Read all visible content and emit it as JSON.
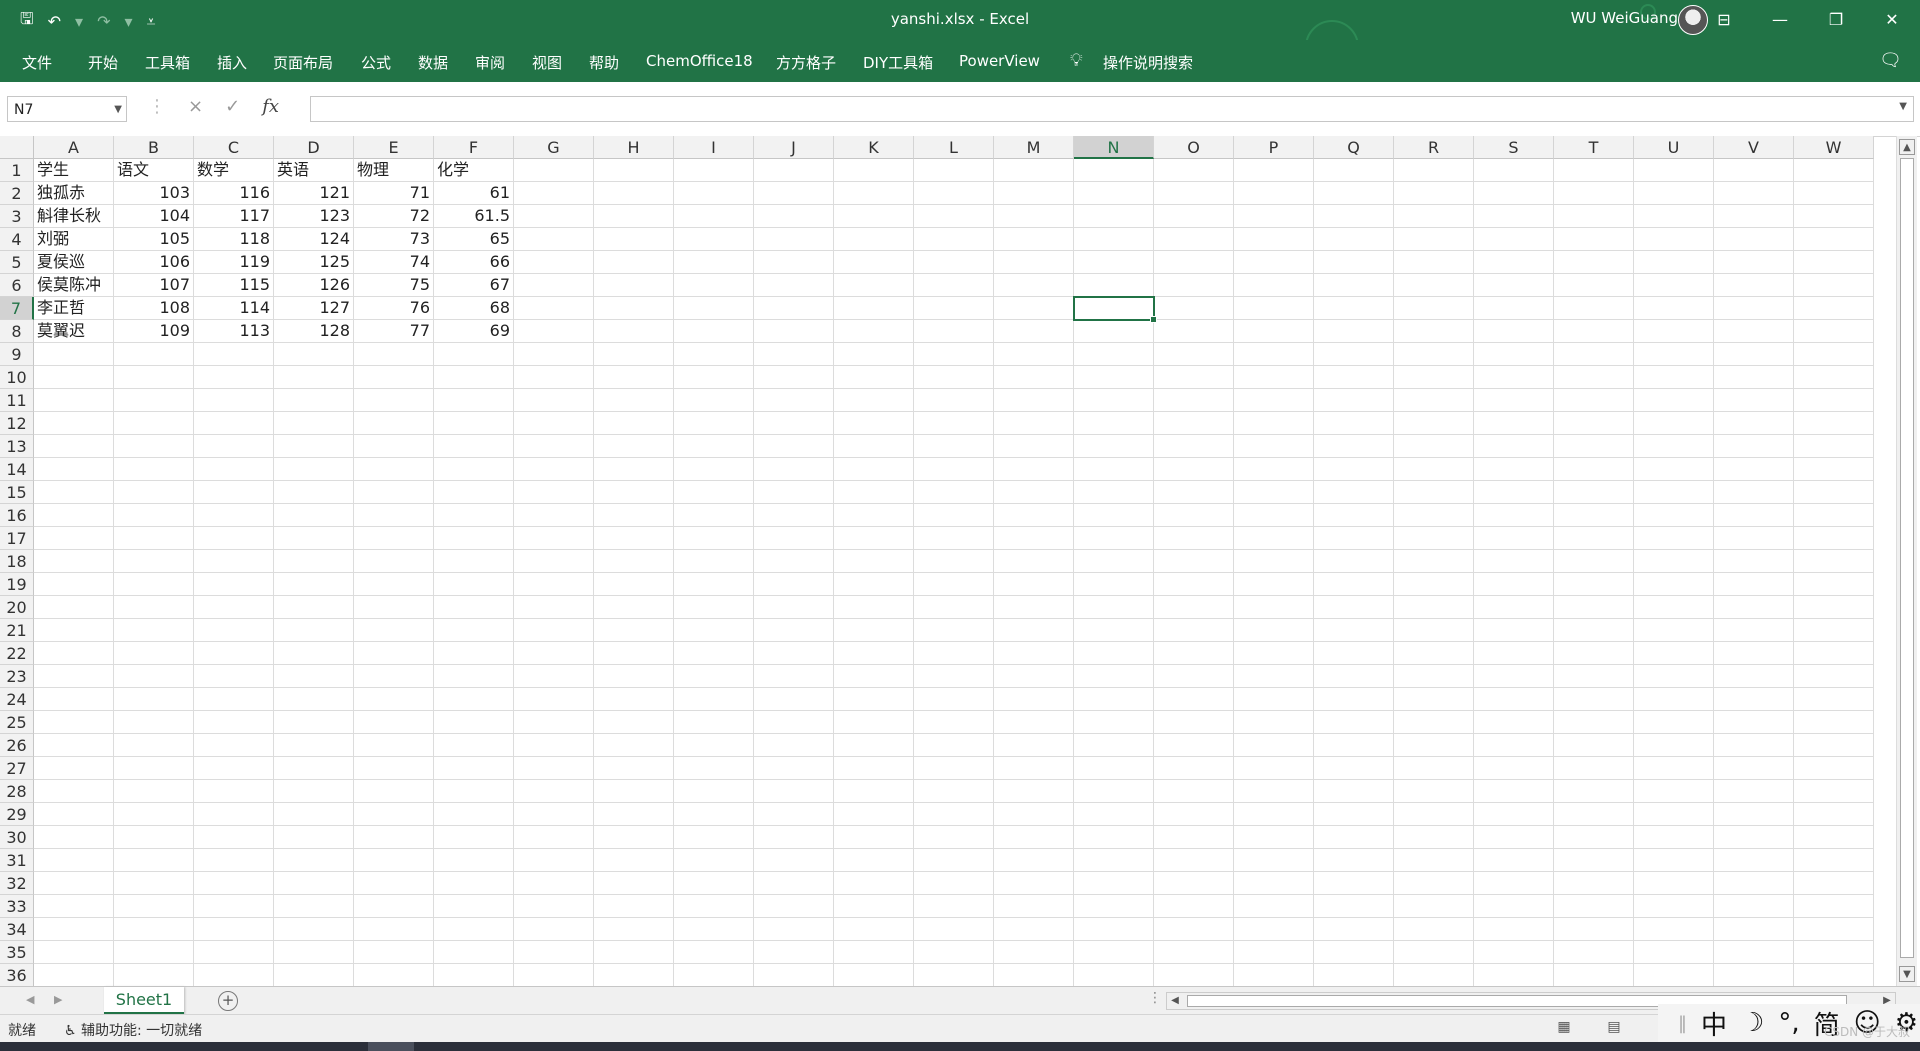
{
  "window": {
    "title": "yanshi.xlsx  -  Excel",
    "user": "WU WeiGuang",
    "accent": "#217346"
  },
  "qat": {
    "save_icon": "save-icon",
    "undo_icon": "undo-icon",
    "redo_icon": "redo-icon",
    "customize_icon": "customize-qat-icon"
  },
  "ribbon": {
    "tabs": [
      "文件",
      "开始",
      "工具箱",
      "插入",
      "页面布局",
      "公式",
      "数据",
      "审阅",
      "视图",
      "帮助",
      "ChemOffice18",
      "方方格子",
      "DIY工具箱",
      "PowerView"
    ],
    "tell_me": "操作说明搜索"
  },
  "formula_bar": {
    "name_box": "N7",
    "cancel_icon": "×",
    "enter_icon": "✓",
    "fx": "fx",
    "content": ""
  },
  "sheet": {
    "columns": [
      "A",
      "B",
      "C",
      "D",
      "E",
      "F",
      "G",
      "H",
      "I",
      "J",
      "K",
      "L",
      "M",
      "N",
      "O",
      "P",
      "Q",
      "R",
      "S",
      "T",
      "U",
      "V",
      "W"
    ],
    "row_count": 36,
    "selected_cell": "N7",
    "rows": [
      [
        "学生",
        "语文",
        "数学",
        "英语",
        "物理",
        "化学"
      ],
      [
        "独孤赤",
        "103",
        "116",
        "121",
        "71",
        "61"
      ],
      [
        "斛律长秋",
        "104",
        "117",
        "123",
        "72",
        "61.5"
      ],
      [
        "刘弼",
        "105",
        "118",
        "124",
        "73",
        "65"
      ],
      [
        "夏侯巡",
        "106",
        "119",
        "125",
        "74",
        "66"
      ],
      [
        "侯莫陈冲",
        "107",
        "115",
        "126",
        "75",
        "67"
      ],
      [
        "李正哲",
        "108",
        "114",
        "127",
        "76",
        "68"
      ],
      [
        "莫翼迟",
        "109",
        "113",
        "128",
        "77",
        "69"
      ]
    ]
  },
  "sheet_tabs": {
    "tabs": [
      "Sheet1"
    ],
    "add_sheet": "+"
  },
  "status": {
    "ready": "就绪",
    "accessibility": "辅助功能: 一切就绪"
  },
  "ime": {
    "items": [
      "中",
      "☽",
      "°,",
      "简",
      "☺",
      "⚙"
    ]
  },
  "watermark": "CSDN @于大叔"
}
